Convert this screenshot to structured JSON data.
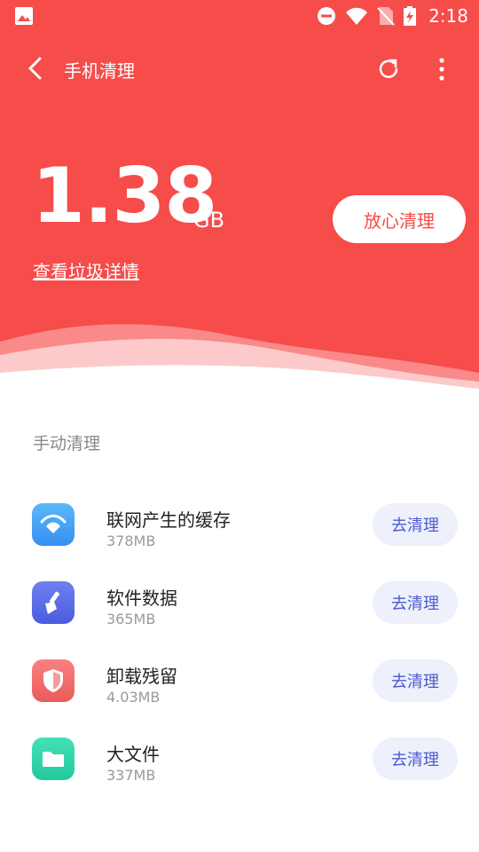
{
  "status_bar": {
    "time": "2:18",
    "icons": [
      "gallery-icon",
      "dnd-icon",
      "wifi-icon",
      "no-sim-icon",
      "battery-charging-icon"
    ]
  },
  "toolbar": {
    "title": "手机清理",
    "icons": [
      "back-icon",
      "refresh-icon",
      "more-icon"
    ]
  },
  "summary": {
    "size_value": "1.38",
    "size_unit": "GB",
    "detail_link": "查看垃圾详情",
    "clean_button": "放心清理"
  },
  "manual": {
    "section_title": "手动清理",
    "items": [
      {
        "name": "联网产生的缓存",
        "size": "378MB",
        "button": "去清理",
        "icon": "wifi-icon",
        "color": "#3b9bf5"
      },
      {
        "name": "软件数据",
        "size": "365MB",
        "button": "去清理",
        "icon": "broom-icon",
        "color": "#5b6ee8"
      },
      {
        "name": "卸载残留",
        "size": "4.03MB",
        "button": "去清理",
        "icon": "shield-icon",
        "color": "#f06a6a"
      },
      {
        "name": "大文件",
        "size": "337MB",
        "button": "去清理",
        "icon": "folder-icon",
        "color": "#2fd3a6"
      }
    ]
  },
  "colors": {
    "accent": "#f64c4a",
    "button_bg": "#eef0fb",
    "button_text": "#4a5bd0"
  }
}
